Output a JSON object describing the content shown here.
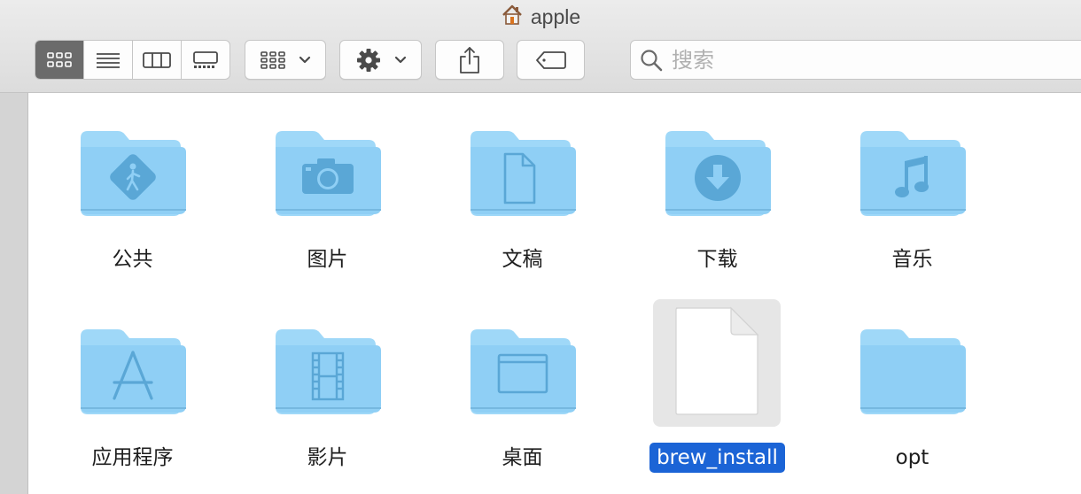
{
  "window": {
    "title": "apple"
  },
  "toolbar": {
    "view_modes": [
      "icon-view",
      "list-view",
      "column-view",
      "gallery-view"
    ],
    "active_view": "icon-view",
    "group_button_icon": "grid-group-icon",
    "action_button_icon": "gear-icon",
    "share_button_icon": "share-icon",
    "tag_button_icon": "tag-icon"
  },
  "search": {
    "placeholder": "搜索"
  },
  "colors": {
    "folder": "#8fcff5",
    "folder_tab": "#9fd8f8",
    "folder_glyph": "#5aa7d6",
    "selection": "#1b64d6"
  },
  "items": [
    {
      "name": "公共",
      "type": "folder",
      "glyph": "public-icon"
    },
    {
      "name": "图片",
      "type": "folder",
      "glyph": "camera-icon"
    },
    {
      "name": "文稿",
      "type": "folder",
      "glyph": "document-icon"
    },
    {
      "name": "下载",
      "type": "folder",
      "glyph": "download-icon"
    },
    {
      "name": "音乐",
      "type": "folder",
      "glyph": "music-icon"
    },
    {
      "name": "应用程序",
      "type": "folder",
      "glyph": "app-store-icon"
    },
    {
      "name": "影片",
      "type": "folder",
      "glyph": "film-icon"
    },
    {
      "name": "桌面",
      "type": "folder",
      "glyph": "desktop-icon"
    },
    {
      "name": "brew_install",
      "type": "file",
      "glyph": "blank-file-icon",
      "selected": true
    },
    {
      "name": "opt",
      "type": "folder",
      "glyph": "plain-folder-icon"
    }
  ]
}
